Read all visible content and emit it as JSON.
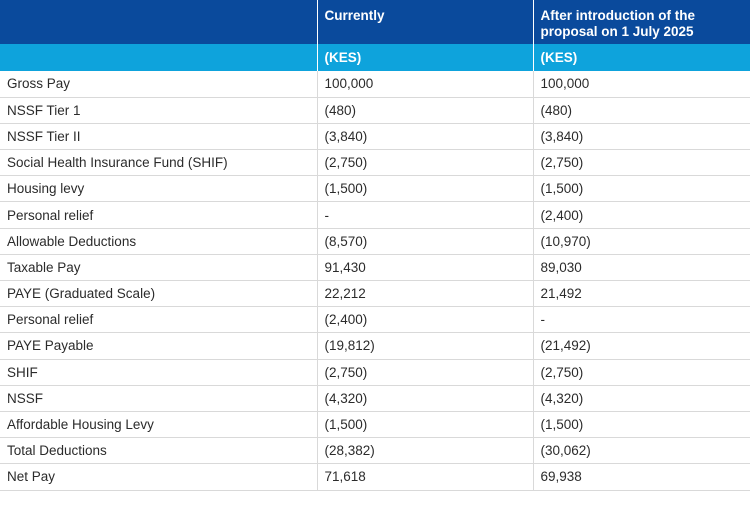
{
  "header": {
    "col1": "",
    "col2": "Currently",
    "col3": "After introduction of the proposal on 1 July 2025"
  },
  "subheader": {
    "col1": "",
    "col2": "(KES)",
    "col3": "(KES)"
  },
  "rows": [
    {
      "label": "Gross Pay",
      "current": "100,000",
      "after": "100,000"
    },
    {
      "label": "NSSF Tier 1",
      "current": "(480)",
      "after": "(480)"
    },
    {
      "label": "NSSF Tier II",
      "current": "(3,840)",
      "after": "(3,840)"
    },
    {
      "label": "Social Health Insurance Fund (SHIF)",
      "current": "(2,750)",
      "after": "(2,750)"
    },
    {
      "label": "Housing levy",
      "current": "(1,500)",
      "after": "(1,500)"
    },
    {
      "label": "Personal relief",
      "current": "-",
      "after": "(2,400)"
    },
    {
      "label": "Allowable Deductions",
      "current": "(8,570)",
      "after": "(10,970)"
    },
    {
      "label": "Taxable Pay",
      "current": "91,430",
      "after": "89,030"
    },
    {
      "label": "PAYE (Graduated Scale)",
      "current": "22,212",
      "after": "21,492"
    },
    {
      "label": "Personal relief",
      "current": "(2,400)",
      "after": "-"
    },
    {
      "label": "PAYE Payable",
      "current": "(19,812)",
      "after": "(21,492)"
    },
    {
      "label": "SHIF",
      "current": "(2,750)",
      "after": "(2,750)"
    },
    {
      "label": "NSSF",
      "current": "(4,320)",
      "after": "(4,320)"
    },
    {
      "label": "Affordable Housing Levy",
      "current": "(1,500)",
      "after": "(1,500)"
    },
    {
      "label": "Total Deductions",
      "current": "(28,382)",
      "after": "(30,062)"
    },
    {
      "label": "Net Pay",
      "current": "71,618",
      "after": "69,938"
    }
  ]
}
